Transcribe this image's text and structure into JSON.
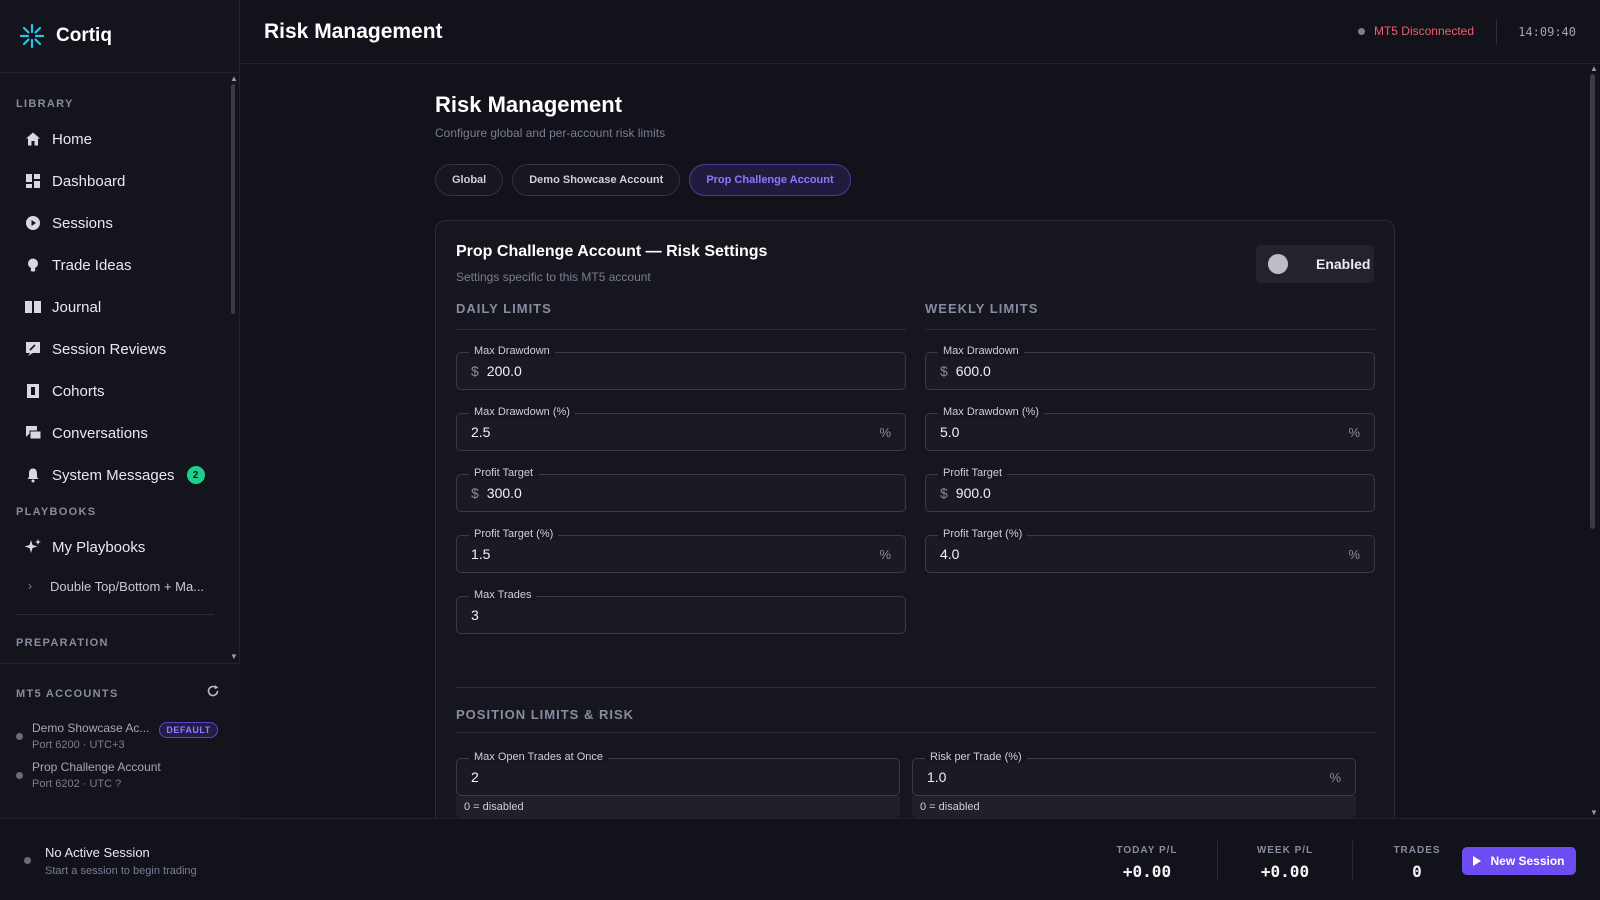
{
  "brand": {
    "name": "Cortiq"
  },
  "header": {
    "title": "Risk Management",
    "connection_status": "MT5 Disconnected",
    "clock": "14:09:40",
    "colors": {
      "status": "#f05d6c"
    }
  },
  "sidebar": {
    "library_label": "LIBRARY",
    "items": [
      {
        "label": "Home",
        "icon": "home-icon"
      },
      {
        "label": "Dashboard",
        "icon": "dashboard-icon"
      },
      {
        "label": "Sessions",
        "icon": "play-circle-icon"
      },
      {
        "label": "Trade Ideas",
        "icon": "lightbulb-icon"
      },
      {
        "label": "Journal",
        "icon": "book-icon"
      },
      {
        "label": "Session Reviews",
        "icon": "rate-review-icon"
      },
      {
        "label": "Cohorts",
        "icon": "cohort-icon"
      },
      {
        "label": "Conversations",
        "icon": "chat-icon"
      },
      {
        "label": "System Messages",
        "icon": "bell-icon",
        "badge": "2"
      }
    ],
    "playbooks_label": "PLAYBOOKS",
    "playbooks": {
      "label": "My Playbooks",
      "icon": "sparkle-icon"
    },
    "playbook_items": [
      {
        "label": "Double Top/Bottom + Ma..."
      }
    ],
    "next_section_label": "PREPARATION"
  },
  "mt5": {
    "label": "MT5 ACCOUNTS",
    "accounts": [
      {
        "name": "Demo Showcase Ac...",
        "sub": "Port 6200 · UTC+3",
        "tag": "DEFAULT"
      },
      {
        "name": "Prop Challenge Account",
        "sub": "Port 6202 · UTC ?"
      }
    ]
  },
  "main": {
    "title": "Risk Management",
    "subtitle": "Configure global and per-account risk limits",
    "tabs": [
      {
        "label": "Global",
        "active": false
      },
      {
        "label": "Demo Showcase Account",
        "active": false
      },
      {
        "label": "Prop Challenge Account",
        "active": true
      }
    ],
    "card": {
      "title": "Prop Challenge Account — Risk Settings",
      "subtitle": "Settings specific to this MT5 account",
      "toggle_label": "Enabled",
      "toggle_on": false,
      "daily": {
        "heading": "DAILY LIMITS",
        "fields": [
          {
            "label": "Max Drawdown",
            "prefix": "$",
            "value": "200.0"
          },
          {
            "label": "Max Drawdown (%)",
            "value": "2.5",
            "suffix": "%"
          },
          {
            "label": "Profit Target",
            "prefix": "$",
            "value": "300.0"
          },
          {
            "label": "Profit Target (%)",
            "value": "1.5",
            "suffix": "%"
          },
          {
            "label": "Max Trades",
            "value": "3"
          }
        ]
      },
      "weekly": {
        "heading": "WEEKLY LIMITS",
        "fields": [
          {
            "label": "Max Drawdown",
            "prefix": "$",
            "value": "600.0"
          },
          {
            "label": "Max Drawdown (%)",
            "value": "5.0",
            "suffix": "%"
          },
          {
            "label": "Profit Target",
            "prefix": "$",
            "value": "900.0"
          },
          {
            "label": "Profit Target (%)",
            "value": "4.0",
            "suffix": "%"
          }
        ]
      },
      "position": {
        "heading": "POSITION LIMITS & RISK",
        "fields": [
          {
            "label": "Max Open Trades at Once",
            "value": "2",
            "hint": "0 = disabled"
          },
          {
            "label": "Risk per Trade (%)",
            "value": "1.0",
            "suffix": "%",
            "hint": "0 = disabled"
          }
        ]
      }
    }
  },
  "footer": {
    "session_title": "No Active Session",
    "session_sub": "Start a session to begin trading",
    "today_label": "TODAY P/L",
    "today_value": "+0.00",
    "week_label": "WEEK P/L",
    "week_value": "+0.00",
    "trades_label": "TRADES",
    "trades_value": "0",
    "new_session": "New Session",
    "colors": {
      "accent": "#6d4df2"
    }
  }
}
